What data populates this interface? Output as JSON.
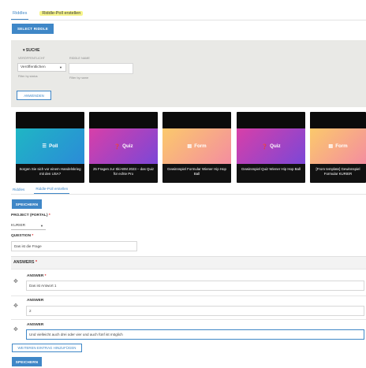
{
  "top_tabs": {
    "riddles": "Riddles",
    "create": "Riddle-Poll erstellen"
  },
  "select_riddle_button": "SELECT RIDDLE",
  "search": {
    "title": "SUCHE",
    "status_label": "VERÖFFENTLICHT",
    "status_value": "Veröffentlichen",
    "status_hint": "Filter by status",
    "name_label": "RIDDLE NAME",
    "name_hint": "Filter by name",
    "apply_button": "ANWENDEN"
  },
  "cards": [
    {
      "type": "Poll",
      "icon": "list-icon",
      "color_top": "#1fb6c4",
      "color_bottom": "#2b8bd8",
      "title": "Sorgen Sie sich vor einem Handelskrieg mit den USA?"
    },
    {
      "type": "Quiz",
      "icon": "question-icon",
      "color_top": "#d83fa8",
      "color_bottom": "#7b47d7",
      "title": "25 Fragen zur Ski-WM 2023 – das Quiz für echte Pro"
    },
    {
      "type": "Form",
      "icon": "form-icon",
      "color_top": "#fbc96b",
      "color_bottom": "#f48da0",
      "title": "Gewinnspiel Formular Wiener Hip Hop Ball"
    },
    {
      "type": "Quiz",
      "icon": "question-icon",
      "color_top": "#d83fa8",
      "color_bottom": "#7b47d7",
      "title": "Gewinnspiel Quiz Wiener Hip Hop Ball"
    },
    {
      "type": "Form",
      "icon": "form-icon",
      "color_top": "#fbc96b",
      "color_bottom": "#f48da0",
      "title": "[From template] Gewinnspiel Formular KURIER"
    }
  ],
  "bottom_tabs": {
    "riddles": "Riddles",
    "create": "Riddle-Poll erstellen"
  },
  "save_button_top": "SPEICHERN",
  "form": {
    "project_label": "PROJECT (PORTAL)",
    "project_value": "KURIER",
    "question_label": "QUESTION",
    "question_value": "Das ist die Frage",
    "answers_label": "ANSWERS",
    "answers": [
      {
        "label": "ANSWER",
        "required": true,
        "value": "Das ist Antwort 1"
      },
      {
        "label": "ANSWER",
        "required": false,
        "value": "2"
      },
      {
        "label": "ANSWER",
        "required": false,
        "value": "Und vielleicht auch drei oder vier und auch fünf ist möglich"
      }
    ],
    "add_entry_button": "WEITEREN EINTRAG HINZUFÜGEN",
    "save_button_bottom": "SPEICHERN",
    "required_mark": "*"
  },
  "accent_color": "#3f87c7"
}
